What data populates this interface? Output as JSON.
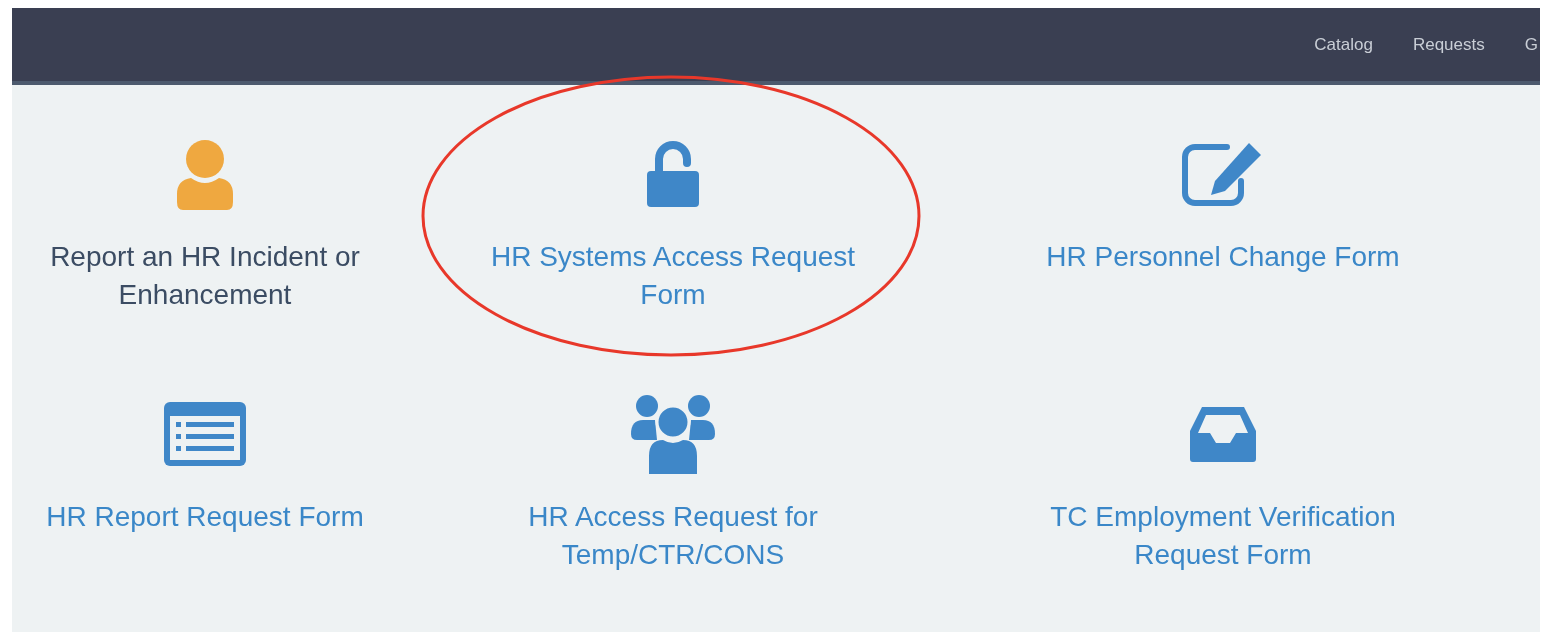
{
  "nav": {
    "items": [
      {
        "label": "Catalog"
      },
      {
        "label": "Requests"
      },
      {
        "label": "G"
      }
    ]
  },
  "catalog": {
    "tiles": [
      {
        "title": "Report an HR Incident or Enhancement",
        "hovered": true,
        "highlighted": false
      },
      {
        "title": "HR Systems Access Request Form",
        "hovered": false,
        "highlighted": true
      },
      {
        "title": "HR Personnel Change Form",
        "hovered": false,
        "highlighted": false
      },
      {
        "title": "HR Report Request Form",
        "hovered": false,
        "highlighted": false
      },
      {
        "title": "HR Access Request for Temp/CTR/CONS",
        "hovered": false,
        "highlighted": false
      },
      {
        "title": "TC Employment Verification Request Form",
        "hovered": false,
        "highlighted": false
      }
    ]
  }
}
